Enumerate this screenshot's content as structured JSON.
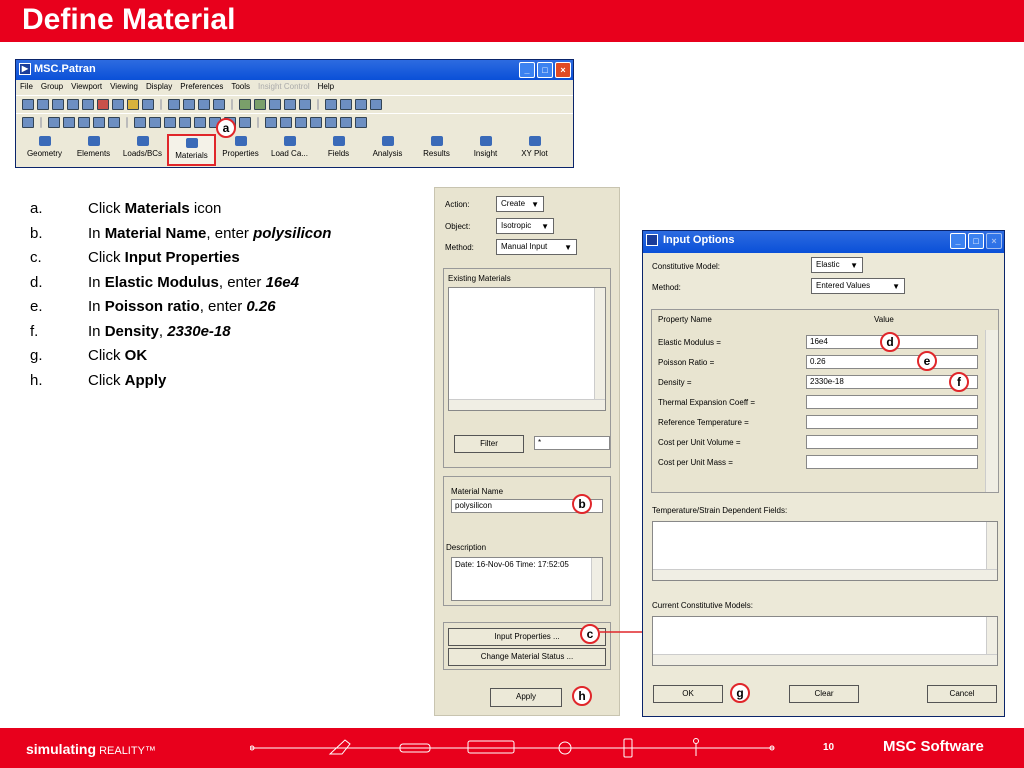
{
  "slide": {
    "title": "Define Material"
  },
  "patran": {
    "title": "MSC.Patran",
    "menu": [
      "File",
      "Group",
      "Viewport",
      "Viewing",
      "Display",
      "Preferences",
      "Tools",
      "Insight Control",
      "Help"
    ],
    "apps": [
      "Geometry",
      "Elements",
      "Loads/BCs",
      "Materials",
      "Properties",
      "Load Ca...",
      "Fields",
      "Analysis",
      "Results",
      "Insight",
      "XY Plot"
    ]
  },
  "steps": [
    {
      "letter": "a.",
      "pre": "Click ",
      "bold": "Materials",
      "mid": " icon",
      "ital": ""
    },
    {
      "letter": "b.",
      "pre": "In ",
      "bold": "Material Name",
      "mid": ", enter ",
      "ital": "polysilicon"
    },
    {
      "letter": "c.",
      "pre": "Click ",
      "bold": "Input Properties",
      "mid": "",
      "ital": ""
    },
    {
      "letter": "d.",
      "pre": "In ",
      "bold": "Elastic Modulus",
      "mid": ", enter ",
      "ital": "16e4"
    },
    {
      "letter": "e.",
      "pre": "In ",
      "bold": "Poisson ratio",
      "mid": ", enter ",
      "ital": "0.26"
    },
    {
      "letter": "f.",
      "pre": "In ",
      "bold": "Density",
      "mid": ", ",
      "ital": "2330e-18"
    },
    {
      "letter": "g.",
      "pre": "Click ",
      "bold": "OK",
      "mid": "",
      "ital": ""
    },
    {
      "letter": "h.",
      "pre": "Click ",
      "bold": "Apply",
      "mid": "",
      "ital": ""
    }
  ],
  "form": {
    "action_label": "Action:",
    "action_value": "Create",
    "object_label": "Object:",
    "object_value": "Isotropic",
    "method_label": "Method:",
    "method_value": "Manual Input",
    "existing_label": "Existing Materials",
    "filter_button": "Filter",
    "filter_value": "*",
    "material_name_label": "Material Name",
    "material_name_value": "polysilicon",
    "description_label": "Description",
    "description_value": "Date: 16-Nov-06        Time: 17:52:05",
    "input_properties_button": "Input Properties ...",
    "change_status_button": "Change Material Status ...",
    "apply_button": "Apply"
  },
  "dialog": {
    "title": "Input Options",
    "constitutive_label": "Constitutive Model:",
    "constitutive_value": "Elastic",
    "method_label": "Method:",
    "method_value": "Entered Values",
    "col_property": "Property Name",
    "col_value": "Value",
    "properties": [
      {
        "name": "Elastic Modulus =",
        "value": "16e4"
      },
      {
        "name": "Poisson Ratio =",
        "value": "0.26"
      },
      {
        "name": "Density =",
        "value": "2330e-18"
      },
      {
        "name": "Thermal Expansion Coeff =",
        "value": ""
      },
      {
        "name": "Reference Temperature =",
        "value": ""
      },
      {
        "name": "Cost per Unit Volume =",
        "value": ""
      },
      {
        "name": "Cost per Unit Mass =",
        "value": ""
      }
    ],
    "temp_label": "Temperature/Strain Dependent Fields:",
    "current_label": "Current Constitutive Models:",
    "ok_button": "OK",
    "clear_button": "Clear",
    "cancel_button": "Cancel"
  },
  "callouts": {
    "a": "a",
    "b": "b",
    "c": "c",
    "d": "d",
    "e": "e",
    "f": "f",
    "g": "g",
    "h": "h"
  },
  "footer": {
    "tagline_bold": "simulating",
    "tagline_rest": " REALITY™",
    "page": "10",
    "logo": "MSC Software"
  },
  "colors": {
    "brand_red": "#e8001c",
    "xp_blue": "#0a50d8",
    "callout_red": "#e0262a"
  }
}
